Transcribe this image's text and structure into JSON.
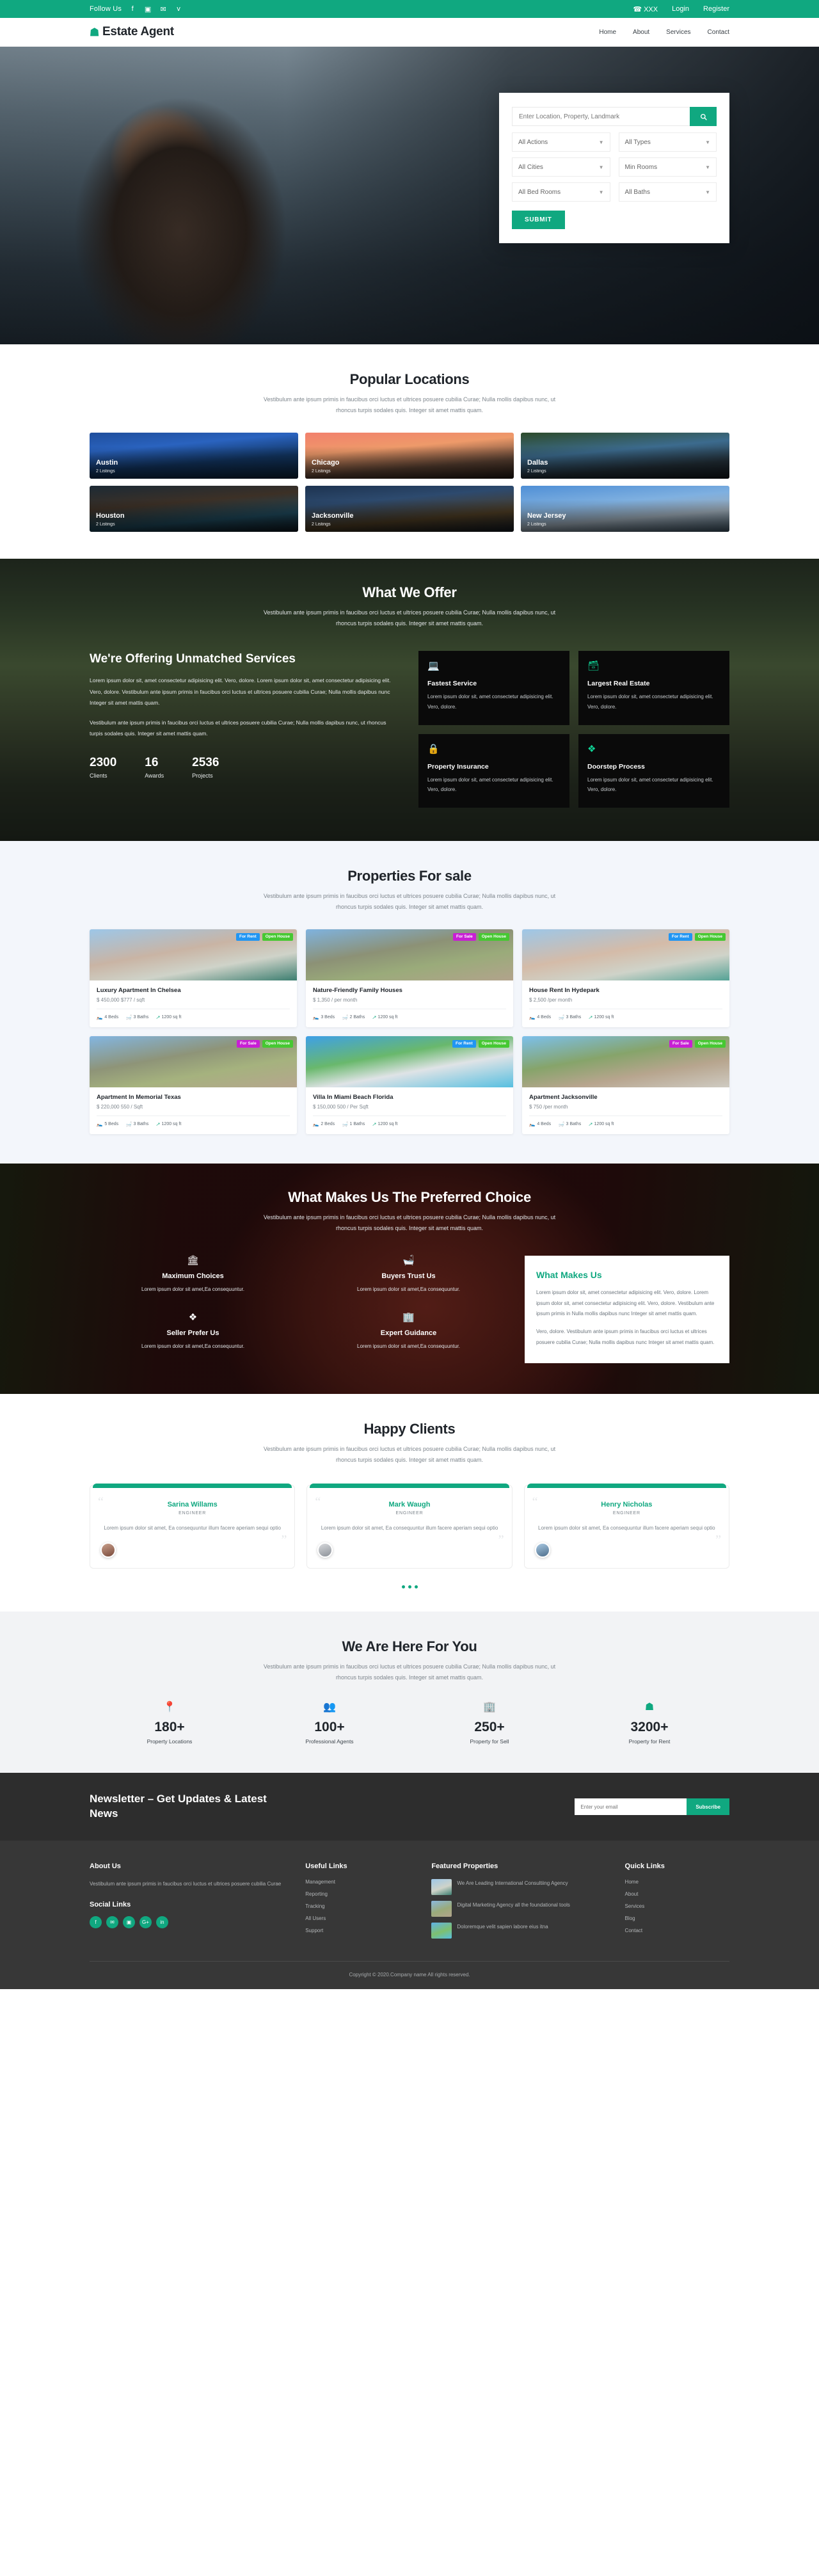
{
  "topbar": {
    "follow_label": "Follow Us",
    "socials": [
      {
        "name": "facebook-icon",
        "glyph": "f"
      },
      {
        "name": "instagram-icon",
        "glyph": "▣"
      },
      {
        "name": "twitter-icon",
        "glyph": "✉"
      },
      {
        "name": "vimeo-icon",
        "glyph": "v"
      }
    ],
    "phone": "☎ XXX",
    "login": "Login",
    "register": "Register"
  },
  "header": {
    "brand": "Estate Agent",
    "brand_icon": "home-icon",
    "nav": [
      "Home",
      "About",
      "Services",
      "Contact"
    ]
  },
  "hero_search": {
    "placeholder": "Enter Location, Property, Landmark",
    "search_icon": "search-icon",
    "selects": [
      {
        "label": "All Actions"
      },
      {
        "label": "All Types"
      },
      {
        "label": "All Cities"
      },
      {
        "label": "Min Rooms"
      },
      {
        "label": "All Bed Rooms"
      },
      {
        "label": "All Baths"
      }
    ],
    "submit": "SUBMIT"
  },
  "locations": {
    "title": "Popular Locations",
    "subtitle": "Vestibulum ante ipsum primis in faucibus orci luctus et ultrices posuere cubilia Curae; Nulla mollis dapibus nunc, ut rhoncus turpis sodales quis. Integer sit amet mattis quam.",
    "items": [
      {
        "name": "Austin",
        "listings": "2 Listings",
        "theme": "bg-austin"
      },
      {
        "name": "Chicago",
        "listings": "2 Listings",
        "theme": "bg-chicago"
      },
      {
        "name": "Dallas",
        "listings": "2 Listings",
        "theme": "bg-dallas"
      },
      {
        "name": "Houston",
        "listings": "2 Listings",
        "theme": "bg-houston"
      },
      {
        "name": "Jacksonville",
        "listings": "2 Listings",
        "theme": "bg-jackson"
      },
      {
        "name": "New Jersey",
        "listings": "2 Listings",
        "theme": "bg-newjersey"
      }
    ]
  },
  "offer": {
    "title": "What We Offer",
    "subtitle": "Vestibulum ante ipsum primis in faucibus orci luctus et ultrices posuere cubilia Curae; Nulla mollis dapibus nunc, ut rhoncus turpis sodales quis. Integer sit amet mattis quam.",
    "heading": "We're Offering Unmatched Services",
    "para1": "Lorem ipsum dolor sit, amet consectetur adipisicing elit. Vero, dolore. Lorem ipsum dolor sit, amet consectetur adipisicing elit. Vero, dolore. Vestibulum ante ipsum primis in faucibus orci luctus et ultrices posuere cubilia Curae; Nulla mollis dapibus nunc Integer sit amet mattis quam.",
    "para2": "Vestibulum ante ipsum primis in faucibus orci luctus et ultrices posuere cubilia Curae; Nulla mollis dapibus nunc, ut rhoncus turpis sodales quis. Integer sit amet mattis quam.",
    "stats": [
      {
        "number": "2300",
        "label": "Clients"
      },
      {
        "number": "16",
        "label": "Awards"
      },
      {
        "number": "2536",
        "label": "Projects"
      }
    ],
    "cards": [
      {
        "icon": "laptop-icon",
        "glyph": "⌨",
        "title": "Fastest Service",
        "desc": "Lorem ipsum dolor sit, amet consectetur adipisicing elit. Vero, dolore."
      },
      {
        "icon": "database-icon",
        "glyph": "☰",
        "title": "Largest Real Estate",
        "desc": "Lorem ipsum dolor sit, amet consectetur adipisicing elit. Vero, dolore."
      },
      {
        "icon": "lock-icon",
        "glyph": "⚿",
        "title": "Property Insurance",
        "desc": "Lorem ipsum dolor sit, amet consectetur adipisicing elit. Vero, dolore."
      },
      {
        "icon": "diamond-icon",
        "glyph": "❖",
        "title": "Doorstep Process",
        "desc": "Lorem ipsum dolor sit, amet consectetur adipisicing elit. Vero, dolore."
      }
    ]
  },
  "properties": {
    "title": "Properties For sale",
    "subtitle": "Vestibulum ante ipsum primis in faucibus orci luctus et ultrices posuere cubilia Curae; Nulla mollis dapibus nunc, ut rhoncus turpis sodales quis. Integer sit amet mattis quam.",
    "items": [
      {
        "title": "Luxury Apartment In Chelsea",
        "price": "$ 450,000 $777 / sqft",
        "beds": "4 Beds",
        "baths": "3 Baths",
        "area": "1200 sq ft",
        "tag1": "For Rent",
        "tag1_type": "rent",
        "tag2": "Open House",
        "theme": "ph-1"
      },
      {
        "title": "Nature-Friendly Family Houses",
        "price": "$ 1,350 / per month",
        "beds": "3 Beds",
        "baths": "2 Baths",
        "area": "1200 sq ft",
        "tag1": "For Sale",
        "tag1_type": "sale",
        "tag2": "Open House",
        "theme": "ph-2"
      },
      {
        "title": "House Rent In Hydepark",
        "price": "$ 2,500 /per month",
        "beds": "4 Beds",
        "baths": "3 Baths",
        "area": "1200 sq ft",
        "tag1": "For Rent",
        "tag1_type": "rent",
        "tag2": "Open House",
        "theme": "ph-3"
      },
      {
        "title": "Apartment In Memorial Texas",
        "price": "$ 220,000 550 / Sqft",
        "beds": "5 Beds",
        "baths": "3 Baths",
        "area": "1200 sq ft",
        "tag1": "For Sale",
        "tag1_type": "sale",
        "tag2": "Open House",
        "theme": "ph-4"
      },
      {
        "title": "Villa In Miami Beach Florida",
        "price": "$ 150,000 500 / Per Sqft",
        "beds": "2 Beds",
        "baths": "1 Baths",
        "area": "1200 sq ft",
        "tag1": "For Rent",
        "tag1_type": "rent",
        "tag2": "Open House",
        "theme": "ph-5"
      },
      {
        "title": "Apartment Jacksonville",
        "price": "$ 750 /per month",
        "beds": "4 Beds",
        "baths": "3 Baths",
        "area": "1200 sq ft",
        "tag1": "For Sale",
        "tag1_type": "sale",
        "tag2": "Open House",
        "theme": "ph-6"
      }
    ]
  },
  "preferred": {
    "title": "What Makes Us The Preferred Choice",
    "subtitle": "Vestibulum ante ipsum primis in faucibus orci luctus et ultrices posuere cubilia Curae; Nulla mollis dapibus nunc, ut rhoncus turpis sodales quis. Integer sit amet mattis quam.",
    "items": [
      {
        "icon": "bank-icon",
        "glyph": "Ἵb",
        "title": "Maximum Choices",
        "desc": "Lorem ipsum dolor sit amet,Ea consequuntur."
      },
      {
        "icon": "bathtub-icon",
        "glyph": "Ὤ1",
        "title": "Buyers Trust Us",
        "desc": "Lorem ipsum dolor sit amet,Ea consequuntur."
      },
      {
        "icon": "cubes-icon",
        "glyph": "❖",
        "title": "Seller Prefer Us",
        "desc": "Lorem ipsum dolor sit amet,Ea consequuntur."
      },
      {
        "icon": "building-icon",
        "glyph": "Ἶ2",
        "title": "Expert Guidance",
        "desc": "Lorem ipsum dolor sit amet,Ea consequuntur."
      }
    ],
    "card_title": "What Makes Us",
    "card_p1": "Lorem ipsum dolor sit, amet consectetur adipisicing elit. Vero, dolore. Lorem ipsum dolor sit, amet consectetur adipisicing elit. Vero, dolore. Vestibulum ante ipsum primis in Nulla mollis dapibus nunc Integer sit amet mattis quam.",
    "card_p2": "Vero, dolore. Vestibulum ante ipsum primis in faucibus orci luctus et ultrices posuere cubilia Curae; Nulla mollis dapibus nunc Integer sit amet mattis quam."
  },
  "testimonials": {
    "title": "Happy Clients",
    "subtitle": "Vestibulum ante ipsum primis in faucibus orci luctus et ultrices posuere cubilia Curae; Nulla mollis dapibus nunc, ut rhoncus turpis sodales quis. Integer sit amet mattis quam.",
    "items": [
      {
        "name": "Sarina Willams",
        "role": "ENGINEER",
        "text": "Lorem ipsum dolor sit amet, Ea consequuntur illum facere aperiam sequi optio",
        "avatar": "av-1"
      },
      {
        "name": "Mark Waugh",
        "role": "ENGINEER",
        "text": "Lorem ipsum dolor sit amet, Ea consequuntur illum facere aperiam sequi optio",
        "avatar": "av-2"
      },
      {
        "name": "Henry Nicholas",
        "role": "ENGINEER",
        "text": "Lorem ipsum dolor sit amet, Ea consequuntur illum facere aperiam sequi optio",
        "avatar": "av-3"
      }
    ]
  },
  "here_for_you": {
    "title": "We Are Here For You",
    "subtitle": "Vestibulum ante ipsum primis in faucibus orci luctus et ultrices posuere cubilia Curae; Nulla mollis dapibus nunc, ut rhoncus turpis sodales quis. Integer sit amet mattis quam.",
    "stats": [
      {
        "icon": "map-marker-icon",
        "glyph": "Ὄd",
        "number": "180+",
        "label": "Property Locations"
      },
      {
        "icon": "users-icon",
        "glyph": "὆5",
        "number": "100+",
        "label": "Professional Agents"
      },
      {
        "icon": "building-icon",
        "glyph": "Ἶ2",
        "number": "250+",
        "label": "Property for Sell"
      },
      {
        "icon": "home-icon",
        "glyph": "⌂",
        "number": "3200+",
        "label": "Property for Rent"
      }
    ]
  },
  "newsletter": {
    "heading": "Newsletter – Get Updates & Latest News",
    "placeholder": "Enter your email",
    "button": "Subscribe"
  },
  "footer": {
    "about_title": "About Us",
    "about_text": "Vestibulum ante ipsum primis in faucibus orci luctus et ultrices posuere cubilia Curae",
    "social_title": "Social Links",
    "socials": [
      {
        "name": "facebook-icon",
        "glyph": "f"
      },
      {
        "name": "twitter-icon",
        "glyph": "✉"
      },
      {
        "name": "instagram-icon",
        "glyph": "▣"
      },
      {
        "name": "google-plus-icon",
        "glyph": "G+"
      },
      {
        "name": "linkedin-icon",
        "glyph": "in"
      }
    ],
    "useful_title": "Useful Links",
    "useful_links": [
      "Management",
      "Reporting",
      "Tracking",
      "All Users",
      "Support"
    ],
    "featured_title": "Featured Properties",
    "featured": [
      {
        "text": "We Are Leading International Consultiing Agency",
        "theme": "fth-1"
      },
      {
        "text": "Digital Marketing Agency all the foundational tools",
        "theme": "fth-2"
      },
      {
        "text": "Doloremque velit sapien labore eius itna",
        "theme": "fth-3"
      }
    ],
    "quick_title": "Quick Links",
    "quick_links": [
      "Home",
      "About",
      "Services",
      "Blog",
      "Contact"
    ],
    "copyright": "Copyright © 2020.Company name All rights reserved."
  },
  "colors": {
    "accent": "#10a880",
    "dark": "#373737",
    "tag_rent": "#2196f3",
    "tag_sale": "#c81fd4",
    "tag_open": "#46c832"
  }
}
